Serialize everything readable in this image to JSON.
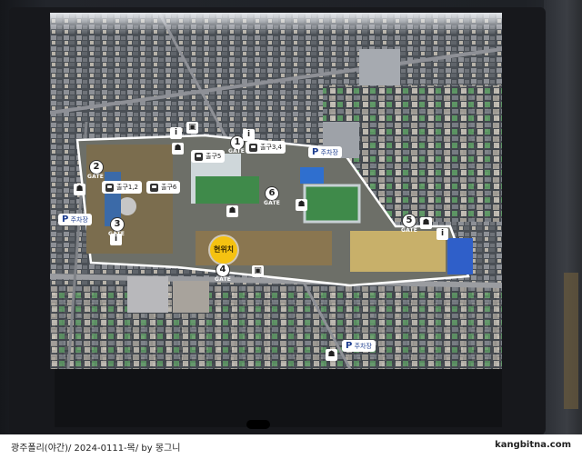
{
  "map": {
    "you_are_here": "현위치",
    "gate_label": "GATE",
    "gate_numbers": [
      "1",
      "2",
      "3",
      "4",
      "5",
      "6"
    ],
    "exits": {
      "exit_12": "출구1,2",
      "exit_34": "출구3,4",
      "exit_5": "출구5",
      "exit_6": "출구6"
    },
    "parking": {
      "label_top": "주차장",
      "label_left": "주차장",
      "label_bottom": "주차장",
      "symbol": "P"
    },
    "icons": [
      "toilet-icon",
      "info-icon",
      "bus-icon",
      "parking-icon"
    ]
  },
  "caption": {
    "left": "광주폴리(야간)/ 2024-0111-목/  by 몽그니",
    "right": "kangbitna.com"
  },
  "colors": {
    "you_are_here": "#f5c211",
    "sign_bg": "#ffffff",
    "park_blue": "#1d3d8f",
    "field": "#c8b06a",
    "solar": "#2f5fc9"
  }
}
